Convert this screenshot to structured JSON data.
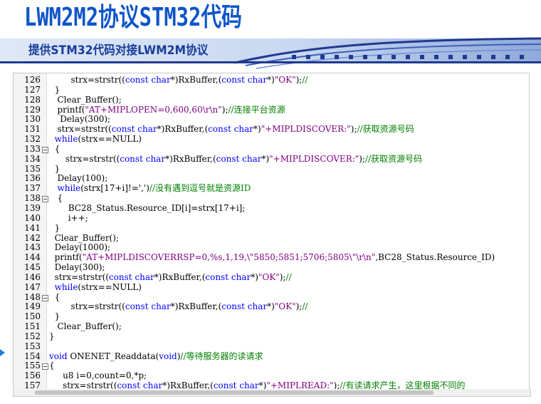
{
  "slide": {
    "title": "LWM2M2协议STM32代码",
    "subtitle": "提供STM32代码对接LWM2M协议"
  },
  "colors": {
    "title": "#0e55c9",
    "keyword": "#0000ff",
    "string": "#800080",
    "comment": "#008000",
    "band": "#2b4fa3"
  },
  "editor": {
    "current_line": "154",
    "lines": [
      {
        "n": "126",
        "fold": "",
        "segs": [
          [
            "t",
            "        strx=strstr(("
          ],
          [
            "k",
            "const"
          ],
          [
            "t",
            " "
          ],
          [
            "k",
            "char"
          ],
          [
            "t",
            "*)RxBuffer,("
          ],
          [
            "k",
            "const"
          ],
          [
            "t",
            " "
          ],
          [
            "k",
            "char"
          ],
          [
            "t",
            "*)"
          ],
          [
            "s",
            "\"OK\""
          ],
          [
            "t",
            ");"
          ],
          [
            "c",
            "//"
          ]
        ]
      },
      {
        "n": "127",
        "fold": "",
        "segs": [
          [
            "t",
            "  }"
          ]
        ]
      },
      {
        "n": "128",
        "fold": "",
        "segs": [
          [
            "t",
            "   Clear_Buffer();"
          ]
        ]
      },
      {
        "n": "129",
        "fold": "",
        "segs": [
          [
            "t",
            "   printf("
          ],
          [
            "s",
            "\"AT+MIPLOPEN=0,600,60\\r\\n\""
          ],
          [
            "t",
            ");"
          ],
          [
            "c",
            "//连接平台资源"
          ]
        ]
      },
      {
        "n": "130",
        "fold": "",
        "segs": [
          [
            "t",
            "    Delay(300);"
          ]
        ]
      },
      {
        "n": "131",
        "fold": "",
        "segs": [
          [
            "t",
            "   strx=strstr(("
          ],
          [
            "k",
            "const"
          ],
          [
            "t",
            " "
          ],
          [
            "k",
            "char"
          ],
          [
            "t",
            "*)RxBuffer,("
          ],
          [
            "k",
            "const"
          ],
          [
            "t",
            " "
          ],
          [
            "k",
            "char"
          ],
          [
            "t",
            "*)"
          ],
          [
            "s",
            "\"+MIPLDISCOVER:\""
          ],
          [
            "t",
            ");"
          ],
          [
            "c",
            "//获取资源号码"
          ]
        ]
      },
      {
        "n": "132",
        "fold": "",
        "segs": [
          [
            "t",
            "  "
          ],
          [
            "k",
            "while"
          ],
          [
            "t",
            "(strx==NULL)"
          ]
        ]
      },
      {
        "n": "133",
        "fold": "box",
        "segs": [
          [
            "t",
            "  {"
          ]
        ]
      },
      {
        "n": "134",
        "fold": "",
        "segs": [
          [
            "t",
            "      strx=strstr(("
          ],
          [
            "k",
            "const"
          ],
          [
            "t",
            " "
          ],
          [
            "k",
            "char"
          ],
          [
            "t",
            "*)RxBuffer,("
          ],
          [
            "k",
            "const"
          ],
          [
            "t",
            " "
          ],
          [
            "k",
            "char"
          ],
          [
            "t",
            "*)"
          ],
          [
            "s",
            "\"+MIPLDISCOVER:\""
          ],
          [
            "t",
            ");"
          ],
          [
            "c",
            "//获取资源号码"
          ]
        ]
      },
      {
        "n": "135",
        "fold": "",
        "segs": [
          [
            "t",
            "  }"
          ]
        ]
      },
      {
        "n": "136",
        "fold": "",
        "segs": [
          [
            "t",
            "   Delay(100);"
          ]
        ]
      },
      {
        "n": "137",
        "fold": "",
        "segs": [
          [
            "t",
            "   "
          ],
          [
            "k",
            "while"
          ],
          [
            "t",
            "(strx[17+i]!=',')"
          ],
          [
            "c",
            "//没有遇到逗号就是资源ID"
          ]
        ]
      },
      {
        "n": "138",
        "fold": "box",
        "segs": [
          [
            "t",
            "   {"
          ]
        ]
      },
      {
        "n": "139",
        "fold": "",
        "segs": [
          [
            "t",
            "       BC28_Status.Resource_ID[i]=strx[17+i];"
          ]
        ]
      },
      {
        "n": "140",
        "fold": "",
        "segs": [
          [
            "t",
            "       i++;"
          ]
        ]
      },
      {
        "n": "141",
        "fold": "",
        "segs": [
          [
            "t",
            "  }"
          ]
        ]
      },
      {
        "n": "142",
        "fold": "",
        "segs": [
          [
            "t",
            "  Clear_Buffer();"
          ]
        ]
      },
      {
        "n": "143",
        "fold": "",
        "segs": [
          [
            "t",
            "  Delay(1000);"
          ]
        ]
      },
      {
        "n": "144",
        "fold": "",
        "segs": [
          [
            "t",
            "  printf("
          ],
          [
            "s",
            "\"AT+MIPLDISCOVERRSP=0,%s,1,19,\\\"5850;5851;5706;5805\\\"\\r\\n\""
          ],
          [
            "t",
            ",BC28_Status.Resource_ID)"
          ]
        ]
      },
      {
        "n": "145",
        "fold": "",
        "segs": [
          [
            "t",
            "  Delay(300);"
          ]
        ]
      },
      {
        "n": "146",
        "fold": "",
        "segs": [
          [
            "t",
            "  strx=strstr(("
          ],
          [
            "k",
            "const"
          ],
          [
            "t",
            " "
          ],
          [
            "k",
            "char"
          ],
          [
            "t",
            "*)RxBuffer,("
          ],
          [
            "k",
            "const"
          ],
          [
            "t",
            " "
          ],
          [
            "k",
            "char"
          ],
          [
            "t",
            "*)"
          ],
          [
            "s",
            "\"OK\""
          ],
          [
            "t",
            ");"
          ],
          [
            "c",
            "//"
          ]
        ]
      },
      {
        "n": "147",
        "fold": "",
        "segs": [
          [
            "t",
            "  "
          ],
          [
            "k",
            "while"
          ],
          [
            "t",
            "(strx==NULL)"
          ]
        ]
      },
      {
        "n": "148",
        "fold": "box",
        "segs": [
          [
            "t",
            "  {"
          ]
        ]
      },
      {
        "n": "149",
        "fold": "",
        "segs": [
          [
            "t",
            "        strx=strstr(("
          ],
          [
            "k",
            "const"
          ],
          [
            "t",
            " "
          ],
          [
            "k",
            "char"
          ],
          [
            "t",
            "*)RxBuffer,("
          ],
          [
            "k",
            "const"
          ],
          [
            "t",
            " "
          ],
          [
            "k",
            "char"
          ],
          [
            "t",
            "*)"
          ],
          [
            "s",
            "\"OK\""
          ],
          [
            "t",
            ");"
          ],
          [
            "c",
            "//"
          ]
        ]
      },
      {
        "n": "150",
        "fold": "",
        "segs": [
          [
            "t",
            "  }"
          ]
        ]
      },
      {
        "n": "151",
        "fold": "",
        "segs": [
          [
            "t",
            "   Clear_Buffer();"
          ]
        ]
      },
      {
        "n": "152",
        "fold": "",
        "segs": [
          [
            "t",
            "}"
          ]
        ]
      },
      {
        "n": "153",
        "fold": "",
        "segs": [
          [
            "t",
            ""
          ]
        ]
      },
      {
        "n": "154",
        "fold": "",
        "segs": [
          [
            "k",
            "void"
          ],
          [
            "t",
            " ONENET_Readdata("
          ],
          [
            "k",
            "void"
          ],
          [
            "t",
            ")"
          ],
          [
            "c",
            "//等待服务器的读请求"
          ]
        ]
      },
      {
        "n": "155",
        "fold": "box",
        "segs": [
          [
            "t",
            "{"
          ]
        ]
      },
      {
        "n": "156",
        "fold": "",
        "segs": [
          [
            "t",
            "     u8 i=0,count=0,*p;"
          ]
        ]
      },
      {
        "n": "157",
        "fold": "",
        "segs": [
          [
            "t",
            "     strx=strstr(("
          ],
          [
            "k",
            "const"
          ],
          [
            "t",
            " "
          ],
          [
            "k",
            "char"
          ],
          [
            "t",
            "*)RxBuffer,("
          ],
          [
            "k",
            "const"
          ],
          [
            "t",
            " "
          ],
          [
            "k",
            "char"
          ],
          [
            "t",
            "*)"
          ],
          [
            "s",
            "\"+MIPLREAD:\""
          ],
          [
            "t",
            ");"
          ],
          [
            "c",
            "//有读请求产生，这里根据不同的"
          ]
        ]
      }
    ]
  }
}
